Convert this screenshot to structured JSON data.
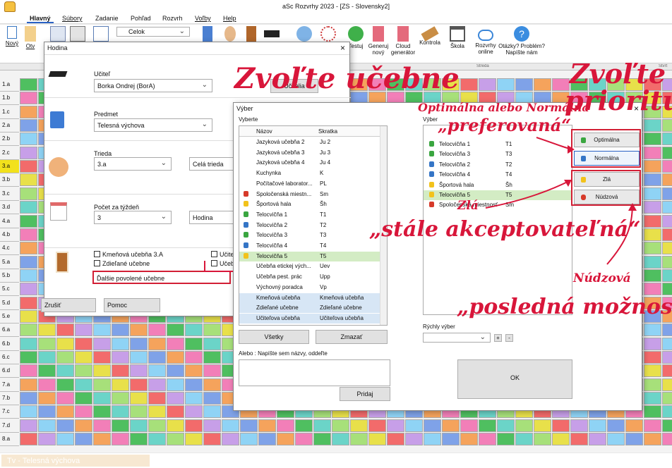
{
  "window": {
    "title": "aSc Rozvrhy 2023  - [ZS - Slovensky2]"
  },
  "menu": [
    "Hlavný",
    "Súbory",
    "Zadanie",
    "Pohľad",
    "Rozvrh",
    "Voľby",
    "Help"
  ],
  "ribbon": {
    "new": "Nový",
    "open": "Otv",
    "view_combo": "Celok",
    "test": "Testuj",
    "generate": "Generuj nový",
    "cloud": "Cloud generátor",
    "check": "Kontrola",
    "school": "Škola",
    "online": "Rozvrhy online",
    "help": "Otázky? Problém? Napíšte nám"
  },
  "grid": {
    "day_label": "Streda",
    "day_label2": "Štvrt",
    "rows": [
      "1.a",
      "1.b",
      "1.c",
      "2.a",
      "2.b",
      "2.c",
      "3.a",
      "3.b",
      "3.c",
      "3.d",
      "4.a",
      "4.b",
      "4.c",
      "5.a",
      "5.b",
      "5.c",
      "5.d",
      "5.e",
      "6.a",
      "6.b",
      "6.c",
      "6.d",
      "7.a",
      "7.b",
      "7.c",
      "7.d",
      "8.a"
    ]
  },
  "hodina_dialog": {
    "title": "Hodina",
    "teacher_label": "Učiteľ",
    "teacher_value": "Borka Ondrej (BorA)",
    "teacher_btn": "Učitelia",
    "subject_label": "Predmet",
    "subject_value": "Telesná výchova",
    "class_label": "Trieda",
    "class_value": "3.a",
    "group_value": "Celá trieda",
    "count_label": "Počet za týždeň",
    "count_value": "3",
    "unit_value": "Hodina",
    "rooms": {
      "home": "Kmeňová učebňa 3.A",
      "shared": "Zdieľané učebne",
      "teacher": "Učiteľ",
      "shared2": "Učeb",
      "other": "Ďalšie povolené učebne"
    },
    "cancel": "Zrušiť",
    "help": "Pomoc"
  },
  "vyber_dialog": {
    "title": "Výber",
    "left_header": "Vyberte",
    "col_name": "Názov",
    "col_short": "Skratka",
    "rows": [
      {
        "name": "Jazyková učebňa 2",
        "short": "Ju 2",
        "pref": ""
      },
      {
        "name": "Jazyková učebňa 3",
        "short": "Ju 3",
        "pref": ""
      },
      {
        "name": "Jazyková učebňa 4",
        "short": "Ju 4",
        "pref": ""
      },
      {
        "name": "Kuchynka",
        "short": "K",
        "pref": ""
      },
      {
        "name": "Počítačové laborator...",
        "short": "PL",
        "pref": ""
      },
      {
        "name": "Spoločenská miestn...",
        "short": "Sm",
        "pref": "red"
      },
      {
        "name": "Športová hala",
        "short": "Šh",
        "pref": "yellow"
      },
      {
        "name": "Telocvičňa 1",
        "short": "T1",
        "pref": "green"
      },
      {
        "name": "Telocvičňa 2",
        "short": "T2",
        "pref": "blue"
      },
      {
        "name": "Telocvičňa 3",
        "short": "T3",
        "pref": "green"
      },
      {
        "name": "Telocvičňa 4",
        "short": "T4",
        "pref": "blue"
      },
      {
        "name": "Telocvičňa 5",
        "short": "T5",
        "pref": "yellow"
      },
      {
        "name": "Učebňa etickej vých...",
        "short": "Uev",
        "pref": ""
      },
      {
        "name": "Učebňa pest. prác",
        "short": "Upp",
        "pref": ""
      },
      {
        "name": "Výchovný poradca",
        "short": "Vp",
        "pref": ""
      },
      {
        "name": "Kmeňová učebňa",
        "short": "Kmeňová učebňa",
        "pref": ""
      },
      {
        "name": "Zdieľané učebne",
        "short": "Zdieľané učebne",
        "pref": ""
      },
      {
        "name": "Učiteľova učebňa",
        "short": "Učiteľova učebňa",
        "pref": ""
      }
    ],
    "right_header": "Výber",
    "selected": [
      {
        "name": "Telocvičňa 1",
        "short": "T1",
        "pref": "green"
      },
      {
        "name": "Telocvičňa 3",
        "short": "T3",
        "pref": "green"
      },
      {
        "name": "Telocvičňa 2",
        "short": "T2",
        "pref": "blue"
      },
      {
        "name": "Telocvičňa 4",
        "short": "T4",
        "pref": "blue"
      },
      {
        "name": "Športová hala",
        "short": "Šh",
        "pref": "yellow"
      },
      {
        "name": "Telocvičňa 5",
        "short": "T5",
        "pref": "yellow"
      },
      {
        "name": "Spoločenská miestnosť",
        "short": "Sm",
        "pref": "red"
      }
    ],
    "all_btn": "Všetky",
    "clear_btn": "Zmazať",
    "quick_label": "Rýchly výber",
    "names_label": "Alebo : Napíšte sem názvy, oddeľte",
    "add_btn": "Pridaj",
    "ok_btn": "OK",
    "priority": {
      "optimal": "Optimálna",
      "normal": "Normálna",
      "bad": "Zlá",
      "emergency": "Núdzová"
    }
  },
  "annotations": {
    "a1": "Zvoľte učebne",
    "a2": "Zvoľte prioritu",
    "a3": "Optimálna alebo Normálna",
    "a4": "„preferovaná“",
    "a5": "Zlá",
    "a6": "„stále akceptovateľná“",
    "a7": "Núdzová",
    "a8": "„posledná možnosť“"
  },
  "status": {
    "subject": "Tv - Telesná výchova"
  },
  "colors": {
    "green": "#3aa640",
    "blue": "#3575c6",
    "yellow": "#f2c21b",
    "red": "#d63a2a",
    "accent_red": "#d21f35"
  }
}
